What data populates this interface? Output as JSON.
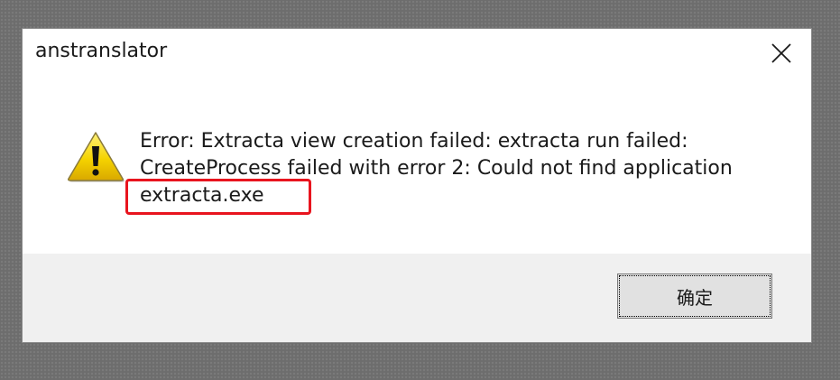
{
  "dialog": {
    "title": "anstranslator",
    "close_icon": "close-icon",
    "warning_icon": "warning-icon",
    "message_lines": [
      "Error: Extracta view creation failed: extracta run failed:",
      "CreateProcess failed with error 2: Could not find application",
      "extracta.exe"
    ],
    "ok_label": "确定"
  },
  "colors": {
    "highlight": "#e8141e",
    "warning_yellow": "#f5d300",
    "footer": "#f0f0f0"
  }
}
